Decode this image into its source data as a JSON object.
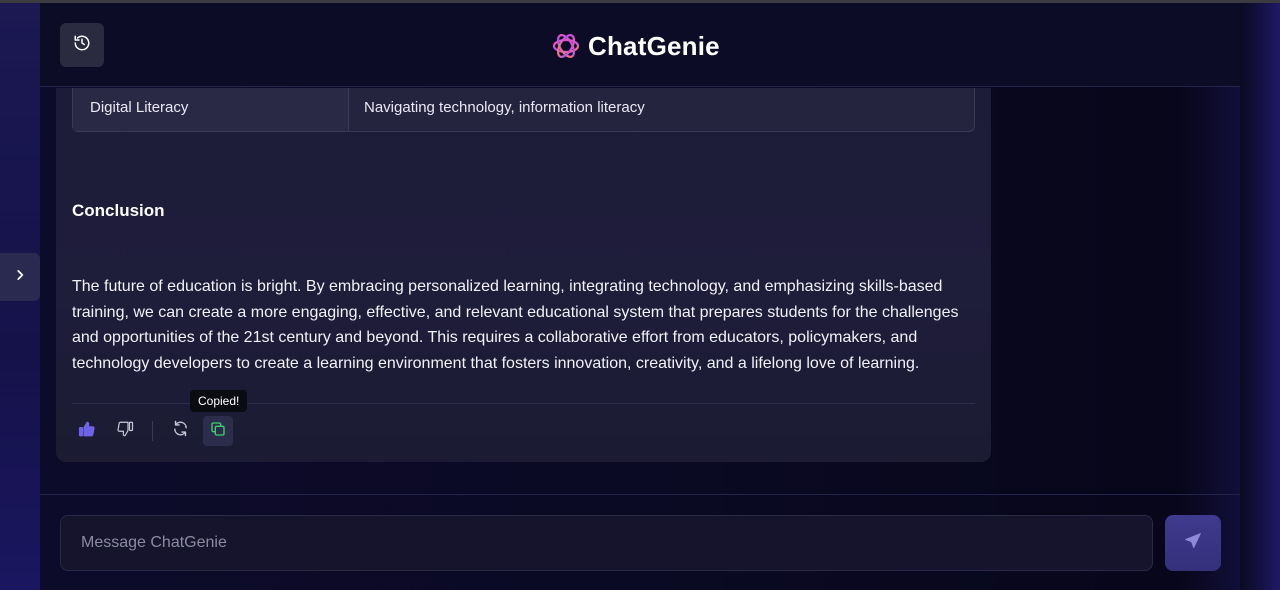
{
  "app": {
    "name": "ChatGenie"
  },
  "header": {
    "history_icon": "history-icon",
    "logo_icon": "chatgenie-logo"
  },
  "table": {
    "rows": [
      {
        "area": "Digital Literacy",
        "description": "Navigating technology, information literacy"
      }
    ]
  },
  "message": {
    "heading": "Conclusion",
    "body": "The future of education is bright. By embracing personalized learning, integrating technology, and emphasizing skills-based training, we can create a more engaging, effective, and relevant educational system that prepares students for the challenges and opportunities of the 21st century and beyond. This requires a collaborative effort from educators, policymakers, and technology developers to create a learning environment that fosters innovation, creativity, and a lifelong love of learning."
  },
  "actions": {
    "tooltip": "Copied!",
    "like_icon": "thumbs-up-icon",
    "dislike_icon": "thumbs-down-icon",
    "regenerate_icon": "refresh-icon",
    "copy_icon": "copy-icon"
  },
  "composer": {
    "placeholder": "Message ChatGenie",
    "value": ""
  },
  "colors": {
    "accent": "#6c63e6",
    "copied_green": "#3ecf6e"
  }
}
